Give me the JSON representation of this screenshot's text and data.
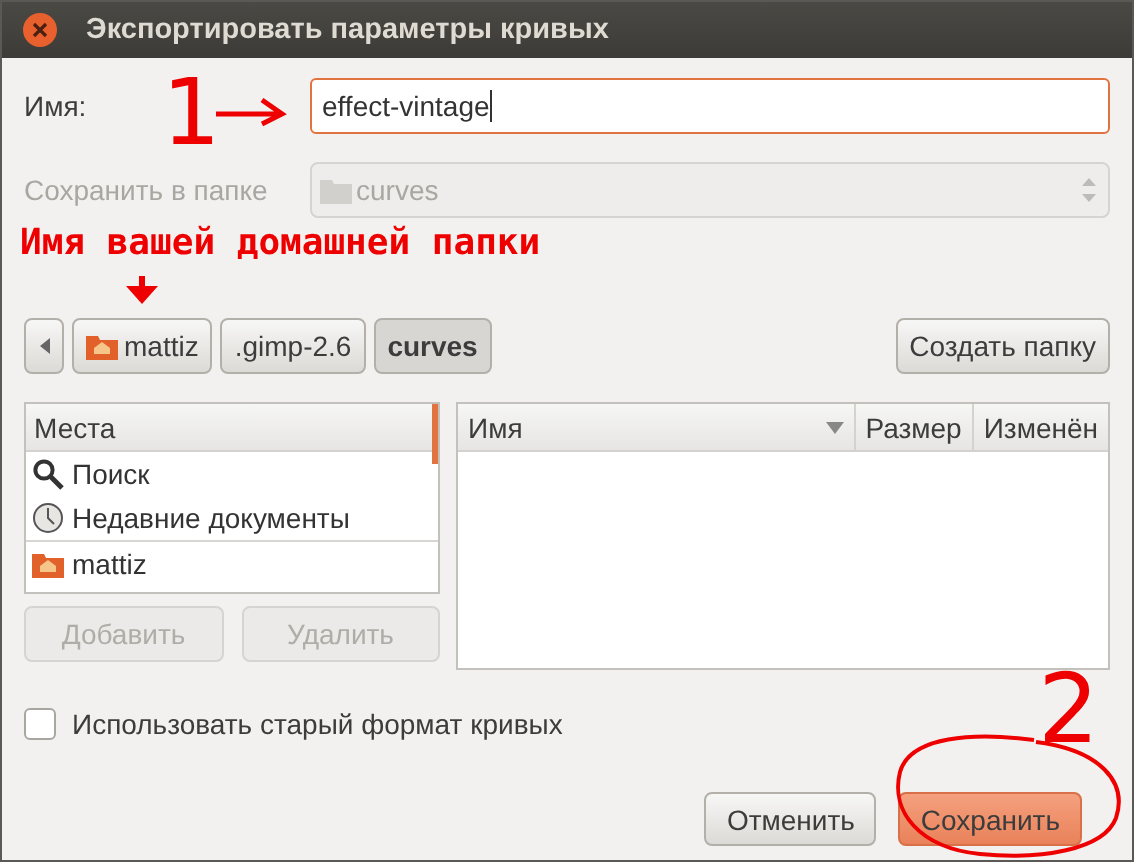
{
  "window": {
    "title": "Экспортировать параметры кривых"
  },
  "name_field": {
    "label": "Имя:",
    "value": "effect-vintage",
    "focused": true
  },
  "folder_field": {
    "label": "Сохранить в папке",
    "value": "curves",
    "disabled": true
  },
  "annotation_label": "Имя вашей домашней папки",
  "path_bar": [
    {
      "label": "mattiz",
      "kind": "home",
      "selected": false
    },
    {
      "label": ".gimp-2.6",
      "kind": "folder",
      "selected": false
    },
    {
      "label": "curves",
      "kind": "folder",
      "selected": true
    }
  ],
  "create_folder_button": "Создать папку",
  "places": {
    "header": "Места",
    "items": [
      {
        "label": "Поиск",
        "kind": "search"
      },
      {
        "label": "Недавние документы",
        "kind": "recent"
      },
      {
        "label": "mattiz",
        "kind": "home"
      }
    ],
    "buttons": [
      {
        "label": "Добавить",
        "disabled": true
      },
      {
        "label": "Удалить",
        "disabled": true
      }
    ]
  },
  "file_list": {
    "columns": [
      {
        "label": "Имя",
        "sorted": true
      },
      {
        "label": "Размер",
        "sorted": false
      },
      {
        "label": "Изменён",
        "sorted": false
      }
    ]
  },
  "checkbox": {
    "label": "Использовать старый формат кривых",
    "checked": false
  },
  "buttons": [
    {
      "label": "Отменить",
      "kind": "default"
    },
    {
      "label": "Сохранить",
      "kind": "primary"
    }
  ],
  "annotations": [
    {
      "text": "1"
    },
    {
      "text": "2"
    }
  ]
}
